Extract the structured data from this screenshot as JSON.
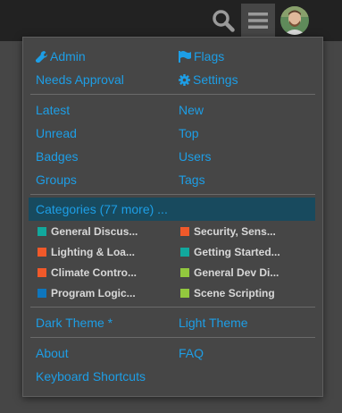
{
  "header": {
    "search_icon": "search-icon",
    "menu_icon": "hamburger-menu-icon",
    "avatar_icon": "user-avatar"
  },
  "menu": {
    "admin": {
      "label": "Admin",
      "icon": "wrench-icon"
    },
    "flags": {
      "label": "Flags",
      "icon": "flag-icon"
    },
    "needs_approval": "Needs Approval",
    "settings": {
      "label": "Settings",
      "icon": "gear-icon"
    },
    "latest": "Latest",
    "new": "New",
    "unread": "Unread",
    "top": "Top",
    "badges": "Badges",
    "users": "Users",
    "groups": "Groups",
    "tags": "Tags",
    "categories_header": "Categories (77 more) ...",
    "categories": [
      {
        "name": "General Discus...",
        "color": "#12a89d"
      },
      {
        "name": "Security, Sens...",
        "color": "#f1592a"
      },
      {
        "name": "Lighting & Loa...",
        "color": "#f1592a"
      },
      {
        "name": "Getting Started...",
        "color": "#12a89d"
      },
      {
        "name": "Climate Contro...",
        "color": "#f1592a"
      },
      {
        "name": "General Dev Di...",
        "color": "#92c83e"
      },
      {
        "name": "Program Logic...",
        "color": "#0e76bd"
      },
      {
        "name": "Scene Scripting",
        "color": "#92c83e"
      }
    ],
    "dark_theme": "Dark Theme *",
    "light_theme": "Light Theme",
    "about": "About",
    "faq": "FAQ",
    "keyboard_shortcuts": "Keyboard Shortcuts"
  },
  "colors": {
    "link": "#1d9ee6",
    "topbar": "#222222",
    "panel": "#464646",
    "category_header_bg": "#184a5e"
  }
}
